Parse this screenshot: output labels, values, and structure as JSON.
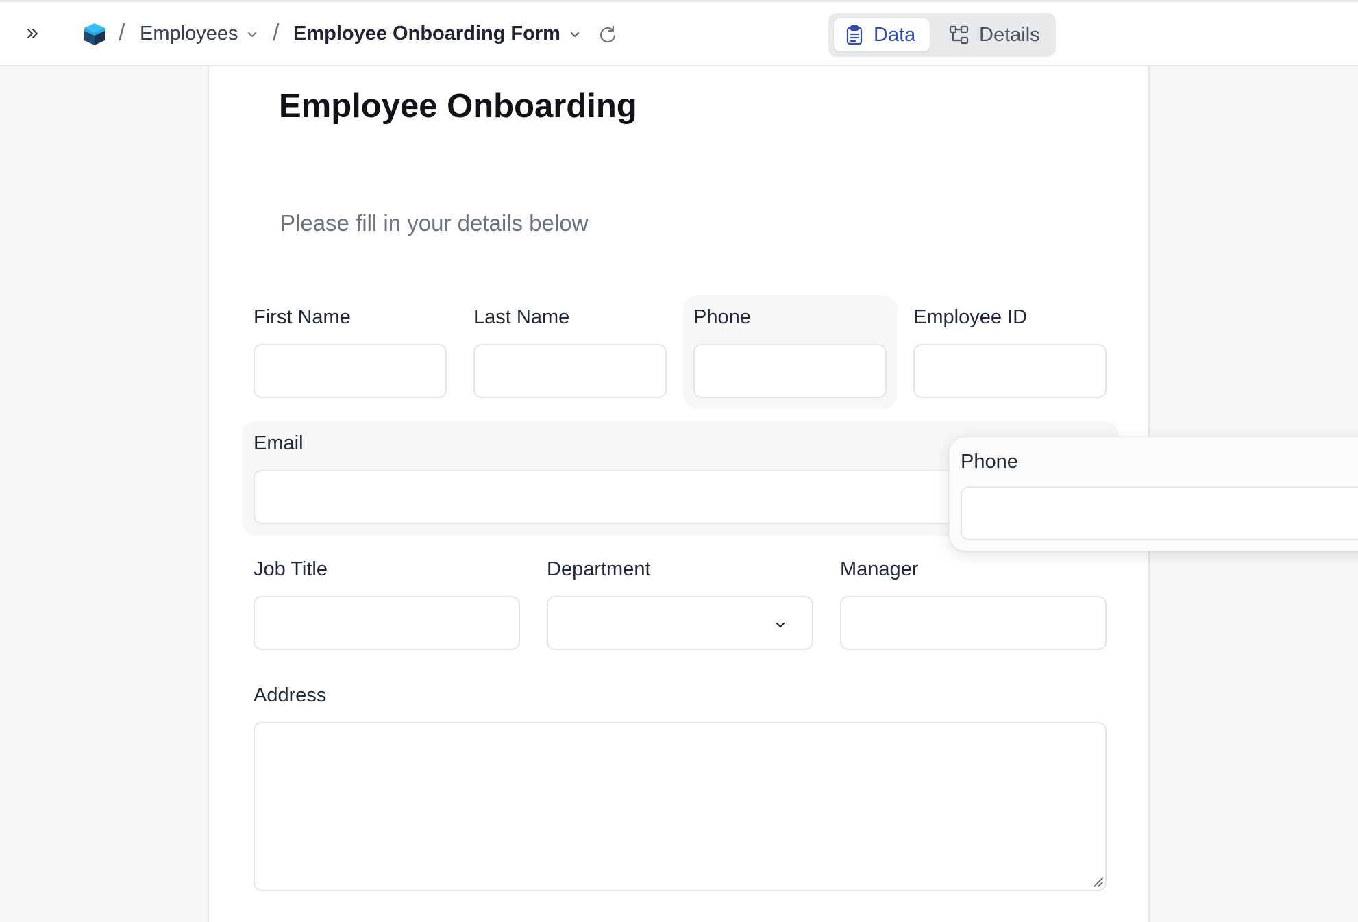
{
  "header": {
    "breadcrumb": {
      "separator": "/",
      "table": "Employees",
      "form": "Employee Onboarding Form"
    },
    "view_switcher": {
      "data_label": "Data",
      "details_label": "Details",
      "selected": "Data"
    }
  },
  "form": {
    "title": "Employee Onboarding",
    "subtitle": "Please fill in your details below",
    "fields": {
      "first_name": {
        "label": "First Name",
        "value": ""
      },
      "last_name": {
        "label": "Last Name",
        "value": ""
      },
      "phone": {
        "label": "Phone",
        "value": ""
      },
      "employee_id": {
        "label": "Employee ID",
        "value": ""
      },
      "email": {
        "label": "Email",
        "value": ""
      },
      "job_title": {
        "label": "Job Title",
        "value": ""
      },
      "department": {
        "label": "Department",
        "value": ""
      },
      "manager": {
        "label": "Manager",
        "value": ""
      },
      "address": {
        "label": "Address",
        "value": ""
      }
    },
    "drag_preview": {
      "label": "Phone"
    }
  },
  "colors": {
    "accent": "#2f49b8",
    "logo_top": "#38bdf8",
    "logo_side": "#1e3a5f"
  },
  "icons": [
    "chevrons-right-icon",
    "app-logo-icon",
    "chevron-down-icon",
    "refresh-icon",
    "clipboard-list-icon",
    "flow-diagram-icon",
    "resize-grip-icon"
  ]
}
